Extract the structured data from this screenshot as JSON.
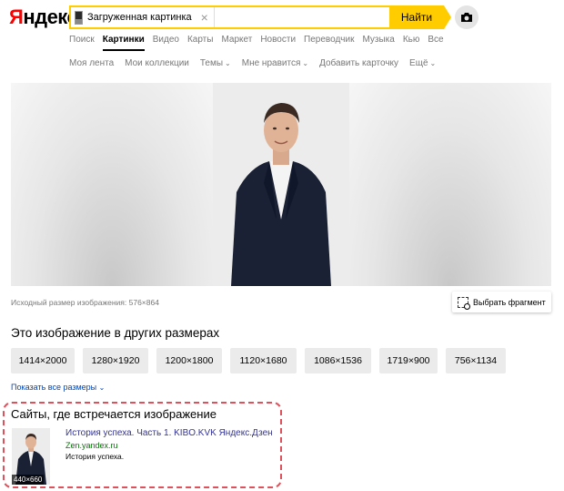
{
  "logo": {
    "first": "Я",
    "rest": "ндекс"
  },
  "search": {
    "chip_text": "Загруженная картинка",
    "clear": "×",
    "find_label": "Найти"
  },
  "camera_icon": "camera-icon",
  "tabs": [
    {
      "label": "Поиск",
      "active": false
    },
    {
      "label": "Картинки",
      "active": true
    },
    {
      "label": "Видео",
      "active": false
    },
    {
      "label": "Карты",
      "active": false
    },
    {
      "label": "Маркет",
      "active": false
    },
    {
      "label": "Новости",
      "active": false
    },
    {
      "label": "Переводчик",
      "active": false
    },
    {
      "label": "Музыка",
      "active": false
    },
    {
      "label": "Кью",
      "active": false
    },
    {
      "label": "Все",
      "active": false
    }
  ],
  "subnav": [
    {
      "label": "Моя лента",
      "chevron": ""
    },
    {
      "label": "Мои коллекции",
      "chevron": ""
    },
    {
      "label": "Темы",
      "chevron": "⌄"
    },
    {
      "label": "Мне нравится",
      "chevron": "⌄"
    },
    {
      "label": "Добавить карточку",
      "chevron": ""
    },
    {
      "label": "Ещё",
      "chevron": "⌄"
    }
  ],
  "viewer": {
    "original_size": "Исходный размер изображения: 576×864",
    "select_fragment": "Выбрать фрагмент"
  },
  "sizes": {
    "title": "Это изображение в других размерах",
    "items": [
      "1414×2000",
      "1280×1920",
      "1200×1800",
      "1120×1680",
      "1086×1536",
      "1719×900",
      "756×1134"
    ],
    "show_all": "Показать все размеры",
    "show_all_chevron": "⌄"
  },
  "sites": {
    "title": "Сайты, где встречается изображение",
    "result": {
      "title": "История успеха. Часть 1. KIBO.KVK Яндекс.Дзен",
      "url": "Zen.yandex.ru",
      "description": "История успеха.",
      "thumb_size": "440×660"
    }
  },
  "colors": {
    "accent_yellow": "#ffcc00",
    "logo_red": "#ff0000",
    "link_blue": "#333399",
    "url_green": "#007700",
    "highlight_dashed": "#e0505a"
  }
}
